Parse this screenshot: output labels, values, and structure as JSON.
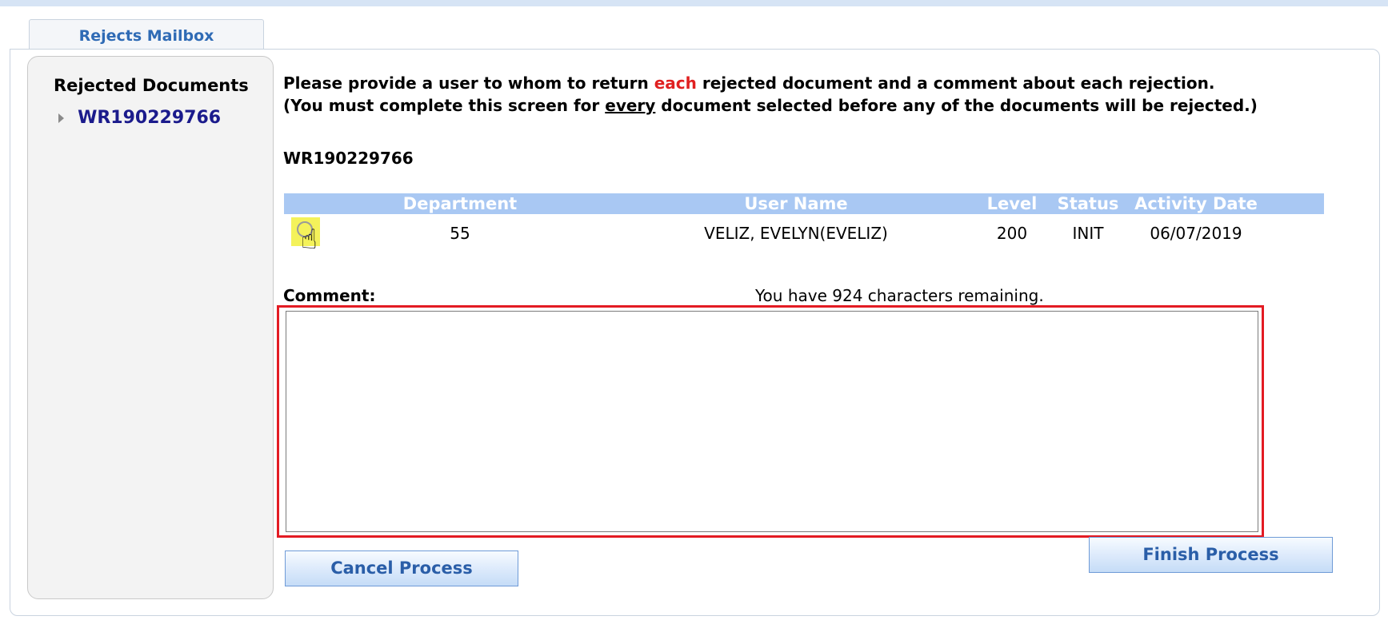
{
  "tab": {
    "label": "Rejects Mailbox"
  },
  "sidebar": {
    "title": "Rejected Documents",
    "items": [
      {
        "label": "WR190229766"
      }
    ]
  },
  "instructions": {
    "line1_a": "Please provide a user to whom to return ",
    "line1_each": "each",
    "line1_b": " rejected document and a comment about each rejection.",
    "line2_a": "(You must complete this screen for ",
    "line2_every": "every",
    "line2_b": " document selected before any of the documents will be rejected.)"
  },
  "document_id": "WR190229766",
  "grid": {
    "headers": {
      "department": "Department",
      "user_name": "User Name",
      "level": "Level",
      "status": "Status",
      "activity_date": "Activity Date"
    },
    "rows": [
      {
        "department": "55",
        "user_name": "VELIZ, EVELYN(EVELIZ)",
        "level": "200",
        "status": "INIT",
        "activity_date": "06/07/2019",
        "selected": false
      }
    ]
  },
  "comment": {
    "label": "Comment:",
    "remaining_text": "You have 924 characters remaining.",
    "value": ""
  },
  "buttons": {
    "cancel": "Cancel Process",
    "finish": "Finish Process"
  },
  "colors": {
    "accent": "#2f6bb5",
    "header_bg": "#a9c8f3",
    "highlight": "#e31b23",
    "cursor_highlight": "#f4f25a"
  },
  "icons": {
    "cursor": "hand-pointer-icon",
    "expand": "triangle-right-icon"
  }
}
